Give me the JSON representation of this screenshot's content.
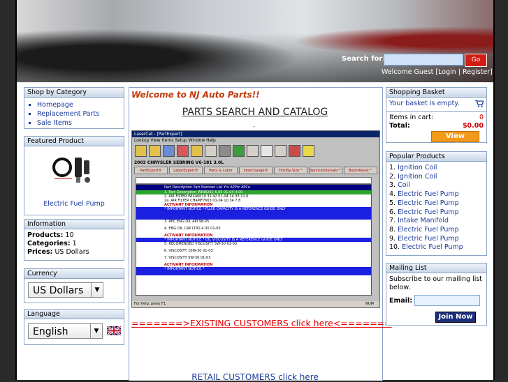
{
  "header": {
    "search_label": "Search for:",
    "search_value": "",
    "go_label": "Go",
    "welcome_text": "Welcome Guest",
    "login_label": "Login",
    "register_label": "Register",
    "sep1": "[",
    "sep2": "|",
    "sep3": "]"
  },
  "left": {
    "categories_title": "Shop by Category",
    "categories": [
      "Homepage",
      "Replacement Parts",
      "Sale Items"
    ],
    "featured_title": "Featured Product",
    "featured_name": "Electric Fuel Pump",
    "info_title": "Information",
    "info": [
      {
        "label": "Products:",
        "value": "10"
      },
      {
        "label": "Categories:",
        "value": "1"
      },
      {
        "label": "Prices:",
        "value": "US Dollars"
      }
    ],
    "currency_title": "Currency",
    "currency_value": "US Dollars",
    "language_title": "Language",
    "language_value": "English"
  },
  "center": {
    "welcome": "Welcome to NJ Auto Parts!!",
    "catalog_title": "PARTS SEARCH AND CATALOG",
    "dot": "-",
    "existing": "=======>EXISTING CUSTOMERS click here<=======",
    "retail": "RETAIL CUSTOMERS click here",
    "shot": {
      "title": "LaserCat - [PartExpert]",
      "menu": "Lookup  View  Items  Setup  Window  Help",
      "vehicle": "2003 CHRYSLER SEBRING V6-181 3.0L",
      "tabs": [
        "PartExpert®",
        "LaborExpert®",
        "Parts & Labor",
        "Interchange®",
        "Tire-By-Size™",
        "ServiceIntervals™",
        "BoomAssist™"
      ],
      "header": "Part Description          Part Number          List   Yrs   APPrc  APCo",
      "rows": [
        "1.   Part Description    WIN8292     6.95   01-04   4.00",
        "2.   AIR FILTER          WIX46019    31.42  01-04   14.33   11.6",
        "2a.  AIR FILTER          CHAMF7663          01-04   10.34   7.8",
        "ACTIVANT INFORMATION",
        "* IMPORTANT NOTICE *     FLUID CAPACITY IS A REFERENCE GUIDE ONLY",
        "3.   REC ENG OIL        API                  98-05",
        "4.   ENG OIL CAP LTRS   4.30                 01-05",
        "ACTIVANT INFORMATION",
        "* IMPORTANT NOTICE *     OIL VISCOSITY IS A REFERENCE GUIDE ONLY",
        "5.   RECOMENDED VISCOSITY   5W-30           01-03",
        "6.   VISCOSITY              10W-30          01-03",
        "7.   VISCOSITY              5W-30           01-03",
        "ACTIVANT INFORMATION",
        "* IMPORTANT NOTICE *"
      ],
      "status": "For Help, press F1",
      "num": "NUM"
    }
  },
  "right": {
    "basket_title": "Shopping Basket",
    "basket_empty": "Your basket is empty.",
    "items_label": "Items in cart:",
    "items_value": "0",
    "total_label": "Total:",
    "total_value": "$0.00",
    "view_basket": "View Basket",
    "popular_title": "Popular Products",
    "popular": [
      {
        "n": "1.",
        "name": "Ignition Coil"
      },
      {
        "n": "2.",
        "name": "Ignition Coil"
      },
      {
        "n": "3.",
        "name": "Coil"
      },
      {
        "n": "4.",
        "name": "Electric Fuel Pump"
      },
      {
        "n": "5.",
        "name": "Electric Fuel Pump"
      },
      {
        "n": "6.",
        "name": "Electric Fuel Pump"
      },
      {
        "n": "7.",
        "name": "Intake Manifold"
      },
      {
        "n": "8.",
        "name": "Electric Fuel Pump"
      },
      {
        "n": "9.",
        "name": "Electric Fuel Pump"
      },
      {
        "n": "10.",
        "name": "Electric Fuel Pump"
      }
    ],
    "mailing_title": "Mailing List",
    "mailing_text": "Subscribe to our mailing list below.",
    "email_label": "Email:",
    "join_label": "Join Now"
  }
}
